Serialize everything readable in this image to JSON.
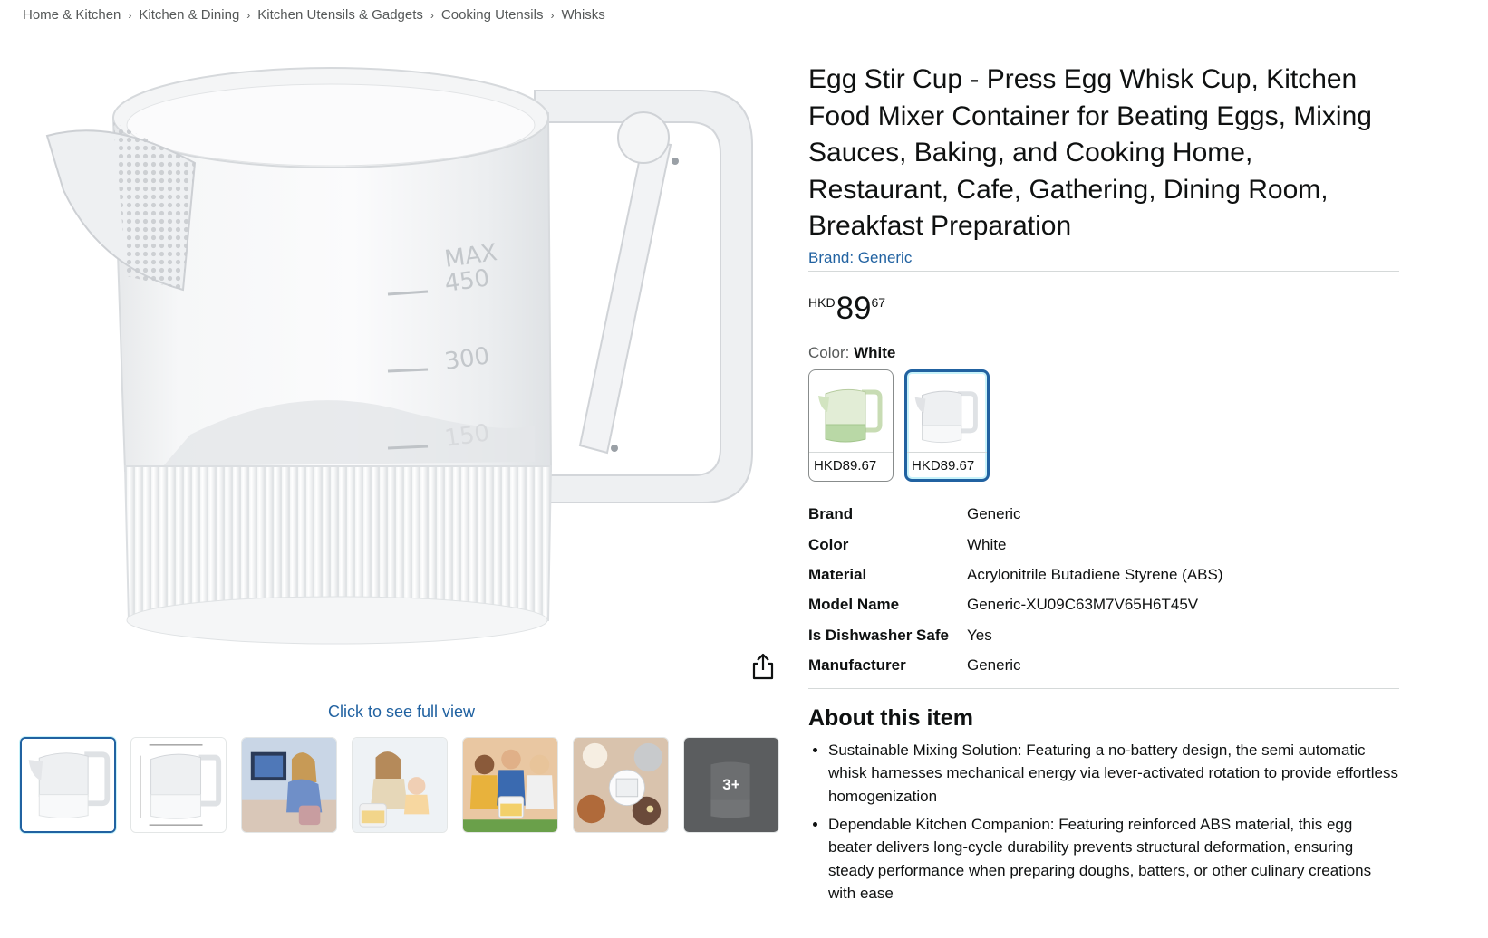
{
  "breadcrumb": [
    "Home & Kitchen",
    "Kitchen & Dining",
    "Kitchen Utensils & Gadgets",
    "Cooking Utensils",
    "Whisks"
  ],
  "product": {
    "title": "Egg Stir Cup - Press Egg Whisk Cup, Kitchen Food Mixer Container for Beating Eggs, Mixing Sauces, Baking, and Cooking Home, Restaurant, Cafe, Gathering, Dining Room, Breakfast Preparation",
    "brand_link": "Brand: Generic",
    "price": {
      "currency": "HKD",
      "whole": "89",
      "fraction": "67"
    },
    "color_label": "Color:",
    "color_value": "White"
  },
  "image_marks": {
    "max": "MAX",
    "v450": "450",
    "v300": "300",
    "v150": "150"
  },
  "gallery": {
    "full_view": "Click to see full view",
    "more_label": "3+"
  },
  "swatches": [
    {
      "price": "HKD89.67",
      "color": "green"
    },
    {
      "price": "HKD89.67",
      "color": "white"
    }
  ],
  "specs": [
    {
      "key": "Brand",
      "value": "Generic"
    },
    {
      "key": "Color",
      "value": "White"
    },
    {
      "key": "Material",
      "value": "Acrylonitrile Butadiene Styrene (ABS)"
    },
    {
      "key": "Model Name",
      "value": "Generic-XU09C63M7V65H6T45V"
    },
    {
      "key": "Is Dishwasher Safe",
      "value": "Yes"
    },
    {
      "key": "Manufacturer",
      "value": "Generic"
    }
  ],
  "about": {
    "title": "About this item",
    "bullets": [
      "Sustainable Mixing Solution: Featuring a no-battery design, the semi automatic whisk harnesses mechanical energy via lever-activated rotation to provide effortless homogenization",
      "Dependable Kitchen Companion: Featuring reinforced ABS material, this egg beater delivers long-cycle durability prevents structural deformation, ensuring steady performance when preparing doughs, batters, or other culinary creations with ease"
    ]
  },
  "colors": {
    "link": "#2162a1",
    "text": "#0f1111",
    "muted": "#565959"
  },
  "icons": {
    "separator": "chevron-right-icon",
    "share": "share-icon"
  }
}
